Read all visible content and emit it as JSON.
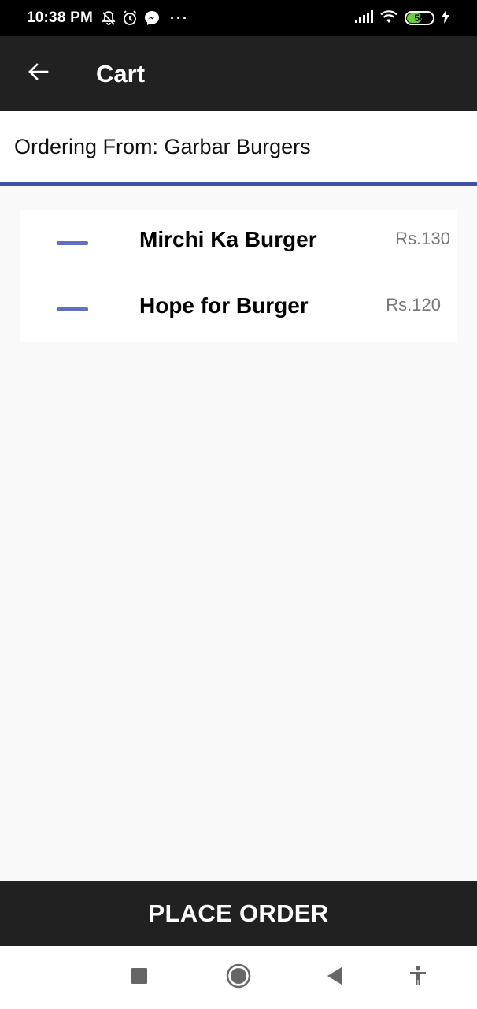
{
  "status_bar": {
    "time": "10:38 PM",
    "overflow_dots": "···",
    "battery_level": "56",
    "icons": [
      "notifications-off-icon",
      "alarm-icon",
      "messenger-icon",
      "signal-icon",
      "wifi-icon",
      "battery-icon",
      "charging-icon"
    ]
  },
  "app_bar": {
    "title": "Cart",
    "back_icon": "arrow-left-icon"
  },
  "header": {
    "ordering_from": "Ordering From: Garbar Burgers"
  },
  "cart": {
    "items": [
      {
        "name": "Mirchi Ka Burger",
        "price": "Rs.130"
      },
      {
        "name": "Hope for Burger",
        "price": "Rs.120"
      }
    ]
  },
  "footer": {
    "place_order_label": "PLACE ORDER"
  },
  "nav": {
    "icons": [
      "recents-square-icon",
      "home-circle-icon",
      "back-triangle-icon",
      "accessibility-icon"
    ]
  },
  "colors": {
    "app_bar": "#212121",
    "accent_underline": "#3f51a5",
    "remove_icon": "#5f71bf",
    "battery_fill": "#6ecb3c"
  }
}
